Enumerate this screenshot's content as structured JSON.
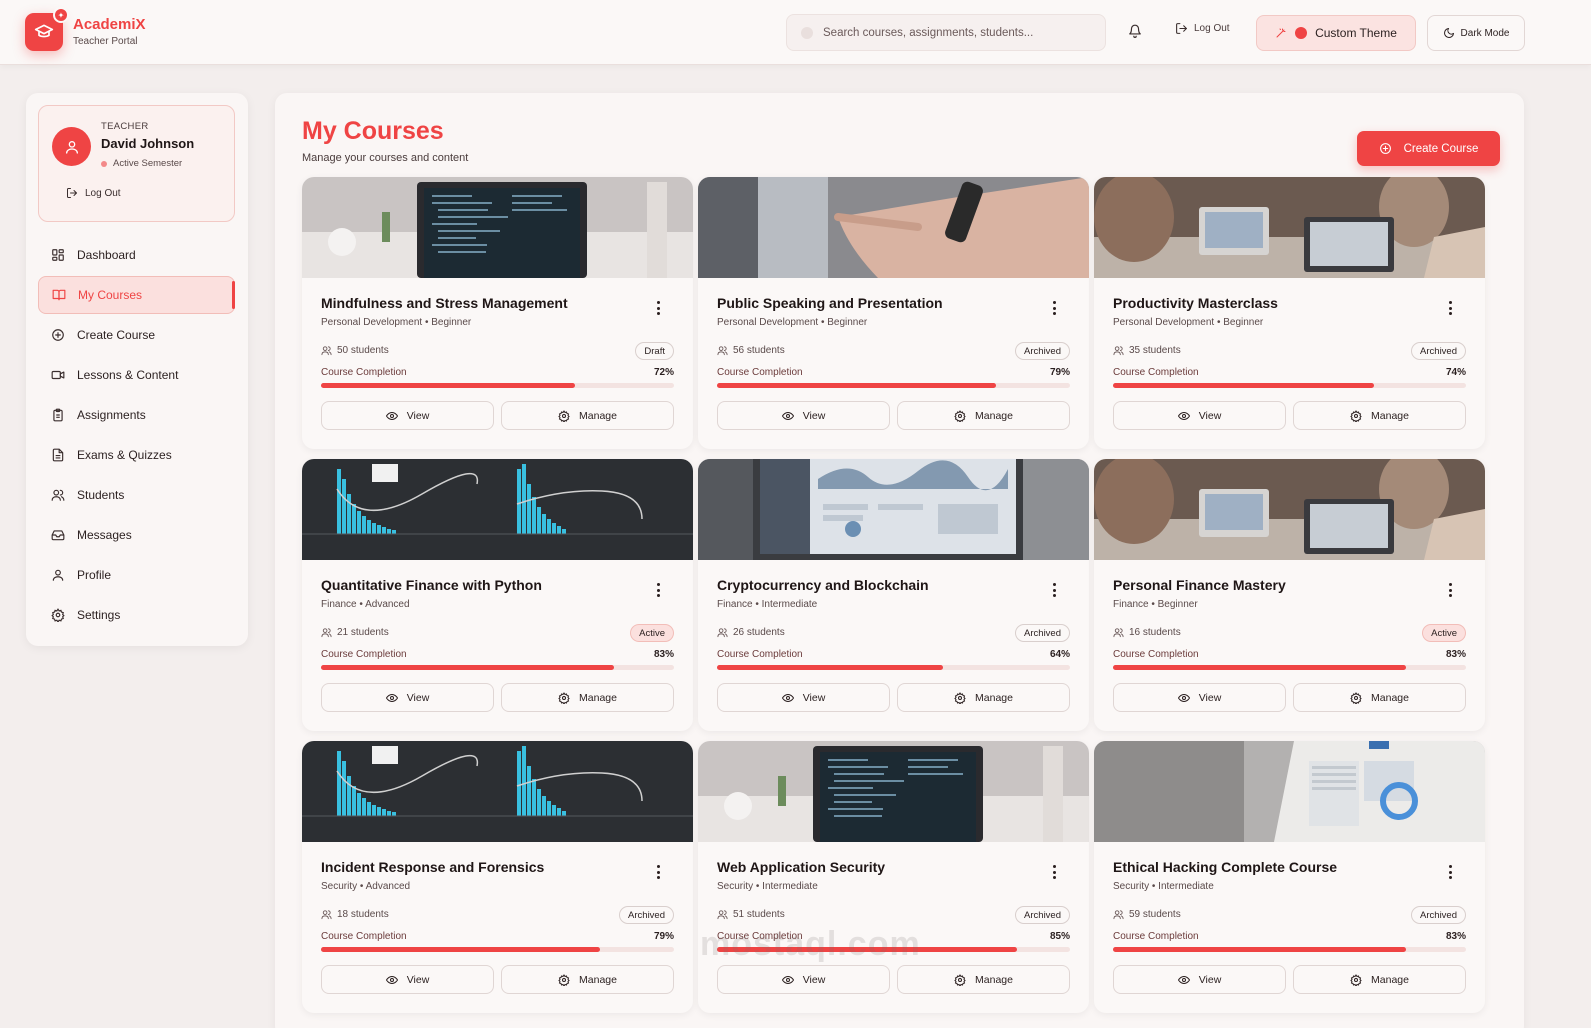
{
  "brand": {
    "name": "AcademiX",
    "subtitle": "Teacher Portal"
  },
  "header": {
    "search_placeholder": "Search courses, assignments, students...",
    "logout_label": "Log Out",
    "theme_label": "Custom Theme",
    "dark_label": "Dark Mode"
  },
  "profile": {
    "role": "TEACHER",
    "name": "David Johnson",
    "status": "Active Semester",
    "logout_label": "Log Out"
  },
  "nav": [
    {
      "label": "Dashboard",
      "icon": "grid-icon"
    },
    {
      "label": "My Courses",
      "icon": "book-icon",
      "active": true
    },
    {
      "label": "Create Course",
      "icon": "plus-circle-icon"
    },
    {
      "label": "Lessons & Content",
      "icon": "video-icon"
    },
    {
      "label": "Assignments",
      "icon": "clipboard-icon"
    },
    {
      "label": "Exams & Quizzes",
      "icon": "file-text-icon"
    },
    {
      "label": "Students",
      "icon": "users-icon"
    },
    {
      "label": "Messages",
      "icon": "inbox-icon"
    },
    {
      "label": "Profile",
      "icon": "user-icon"
    },
    {
      "label": "Settings",
      "icon": "gear-icon"
    }
  ],
  "page": {
    "title": "My Courses",
    "subtitle": "Manage your courses and content",
    "create_label": "Create Course"
  },
  "labels": {
    "completion": "Course Completion",
    "view": "View",
    "manage": "Manage"
  },
  "courses": [
    {
      "title": "Mindfulness and Stress Management",
      "meta": "Personal Development • Beginner",
      "students": "50 students",
      "status": "Draft",
      "completion": 72,
      "completion_label": "72%",
      "image": "laptop-code"
    },
    {
      "title": "Public Speaking and Presentation",
      "meta": "Personal Development • Beginner",
      "students": "56 students",
      "status": "Archived",
      "completion": 79,
      "completion_label": "79%",
      "image": "hand-pointing"
    },
    {
      "title": "Productivity Masterclass",
      "meta": "Personal Development • Beginner",
      "students": "35 students",
      "status": "Archived",
      "completion": 74,
      "completion_label": "74%",
      "image": "people-laptops"
    },
    {
      "title": "Quantitative Finance with Python",
      "meta": "Finance • Advanced",
      "students": "21 students",
      "status": "Active",
      "completion": 83,
      "completion_label": "83%",
      "image": "histogram"
    },
    {
      "title": "Cryptocurrency and Blockchain",
      "meta": "Finance • Intermediate",
      "students": "26 students",
      "status": "Archived",
      "completion": 64,
      "completion_label": "64%",
      "image": "dashboard-laptop"
    },
    {
      "title": "Personal Finance Mastery",
      "meta": "Finance • Beginner",
      "students": "16 students",
      "status": "Active",
      "completion": 83,
      "completion_label": "83%",
      "image": "people-laptops"
    },
    {
      "title": "Incident Response and Forensics",
      "meta": "Security • Advanced",
      "students": "18 students",
      "status": "Archived",
      "completion": 79,
      "completion_label": "79%",
      "image": "histogram"
    },
    {
      "title": "Web Application Security",
      "meta": "Security • Intermediate",
      "students": "51 students",
      "status": "Archived",
      "completion": 85,
      "completion_label": "85%",
      "image": "laptop-code"
    },
    {
      "title": "Ethical Hacking Complete Course",
      "meta": "Security • Intermediate",
      "students": "59 students",
      "status": "Archived",
      "completion": 83,
      "completion_label": "83%",
      "image": "analytics-screen"
    }
  ],
  "watermark": "mostaql.com",
  "colors": {
    "accent": "#ef4444",
    "background": "#f3eeed",
    "panel": "#faf6f5"
  }
}
